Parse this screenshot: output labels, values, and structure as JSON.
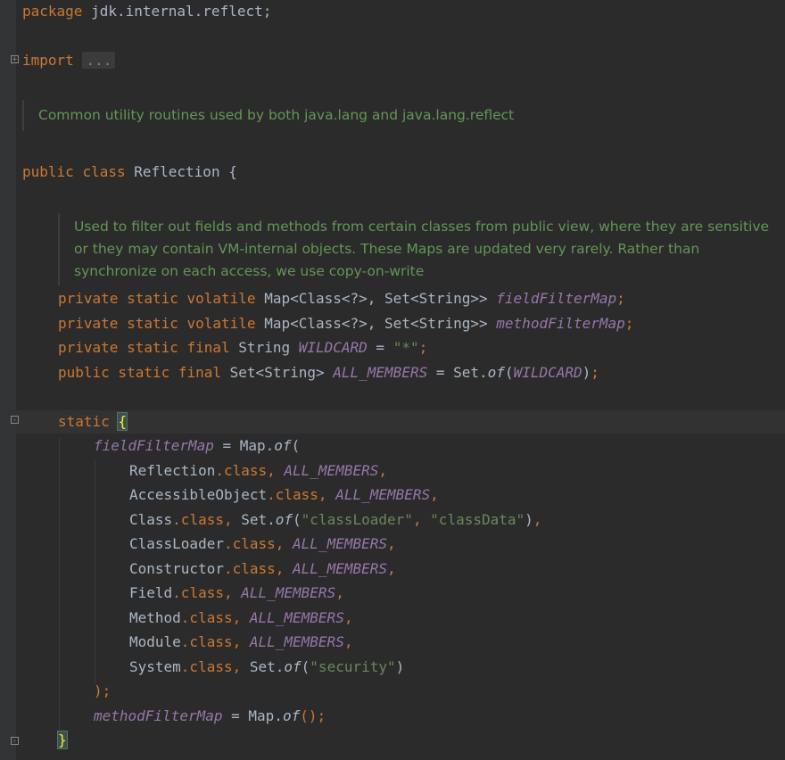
{
  "code": {
    "package_kw": "package",
    "package_name": " jdk.internal.reflect;",
    "import_kw": "import",
    "import_fold": "...",
    "doc1": "Common utility routines used by both java.lang and java.lang.reflect",
    "class_decl": [
      "public",
      " ",
      "class",
      " Reflection {"
    ],
    "doc2": "Used to filter out fields and methods from certain classes from public view, where they are sensitive\nor they may contain VM-internal objects. These Maps are updated very rarely. Rather than\nsynchronize on each access, we use copy-on-write",
    "fields": [
      {
        "mods": "private static volatile ",
        "type": "Map<Class<?>, Set<String>> ",
        "name": "fieldFilterMap",
        "end": ";"
      },
      {
        "mods": "private static volatile ",
        "type": "Map<Class<?>, Set<String>> ",
        "name": "methodFilterMap",
        "end": ";"
      },
      {
        "mods": "private static final ",
        "type": "String ",
        "name": "WILDCARD",
        "eq": " = ",
        "str": "\"*\"",
        "end": ";"
      },
      {
        "mods": "public static final ",
        "type": "Set<String> ",
        "name": "ALL_MEMBERS",
        "eq": " = Set.",
        "call": "of",
        "paren_open": "(",
        "arg": "WILDCARD",
        "paren_close": ")",
        "end": ";"
      }
    ],
    "static_kw": "static",
    "static_brace": "{",
    "ffm_name": "fieldFilterMap",
    "ffm_assign": " = Map.",
    "ffm_call": "of",
    "ffm_paren": "(",
    "entries": [
      {
        "cls": "Reflection",
        "dot_class": ".class",
        "comma": ", ",
        "val": "ALL_MEMBERS",
        "trail": ","
      },
      {
        "cls": "AccessibleObject",
        "dot_class": ".class",
        "comma": ", ",
        "val": "ALL_MEMBERS",
        "trail": ","
      },
      {
        "cls": "Class",
        "dot_class": ".class",
        "comma": ", ",
        "set": "Set.",
        "of": "of",
        "open": "(",
        "s1": "\"classLoader\"",
        "sep": ", ",
        "s2": "\"classData\"",
        "close": ")",
        "trail": ","
      },
      {
        "cls": "ClassLoader",
        "dot_class": ".class",
        "comma": ", ",
        "val": "ALL_MEMBERS",
        "trail": ","
      },
      {
        "cls": "Constructor",
        "dot_class": ".class",
        "comma": ", ",
        "val": "ALL_MEMBERS",
        "trail": ","
      },
      {
        "cls": "Field",
        "dot_class": ".class",
        "comma": ", ",
        "val": "ALL_MEMBERS",
        "trail": ","
      },
      {
        "cls": "Method",
        "dot_class": ".class",
        "comma": ", ",
        "val": "ALL_MEMBERS",
        "trail": ","
      },
      {
        "cls": "Module",
        "dot_class": ".class",
        "comma": ", ",
        "val": "ALL_MEMBERS",
        "trail": ","
      },
      {
        "cls": "System",
        "dot_class": ".class",
        "comma": ", ",
        "set": "Set.",
        "of": "of",
        "open": "(",
        "s1": "\"security\"",
        "close": ")",
        "trail": ""
      }
    ],
    "close_paren": ");",
    "mfm_name": "methodFilterMap",
    "mfm_assign": " = Map.",
    "mfm_call": "of",
    "mfm_end": "();",
    "close_brace": "}"
  },
  "colors": {
    "background": "#2b2b2b",
    "keyword": "#cc7832",
    "string": "#6a8759",
    "field": "#9876aa",
    "doc_comment": "#629755",
    "text": "#a9b7c6"
  }
}
